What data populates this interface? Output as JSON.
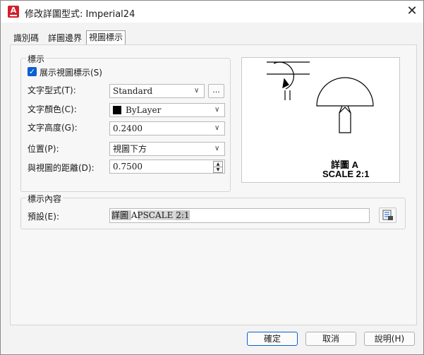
{
  "window": {
    "title": "修改詳圖型式: Imperial24",
    "app_icon_letter": "A"
  },
  "tabs": [
    {
      "label": "識別碼"
    },
    {
      "label": "詳圖邊界"
    },
    {
      "label": "視圖標示",
      "active": true
    }
  ],
  "label_group": {
    "title": "標示",
    "show_label": {
      "label": "展示視圖標示(S)",
      "checked": true
    },
    "text_style": {
      "label": "文字型式(T):",
      "value": "Standard",
      "browse_label": "..."
    },
    "text_color": {
      "label": "文字顏色(C):",
      "value": "ByLayer",
      "swatch_color": "#000000"
    },
    "text_height": {
      "label": "文字高度(G):",
      "value": "0.2400"
    },
    "position": {
      "label": "位置(P):",
      "value": "視圖下方"
    },
    "distance": {
      "label": "與視圖的距離(D):",
      "value": "0.7500"
    }
  },
  "preview": {
    "line1": "詳圖 A",
    "line2": "SCALE 2:1"
  },
  "content_group": {
    "title": "標示內容",
    "default_label": "預設(E):",
    "seg1": "詳圖 ",
    "seg2": "A",
    "seg3": "PSCALE ",
    "seg4": "2:1"
  },
  "footer": {
    "ok": "確定",
    "cancel": "取消",
    "help": "說明(H)"
  },
  "colors": {
    "accent": "#0a5fd2",
    "app_icon": "#d21f2b"
  }
}
